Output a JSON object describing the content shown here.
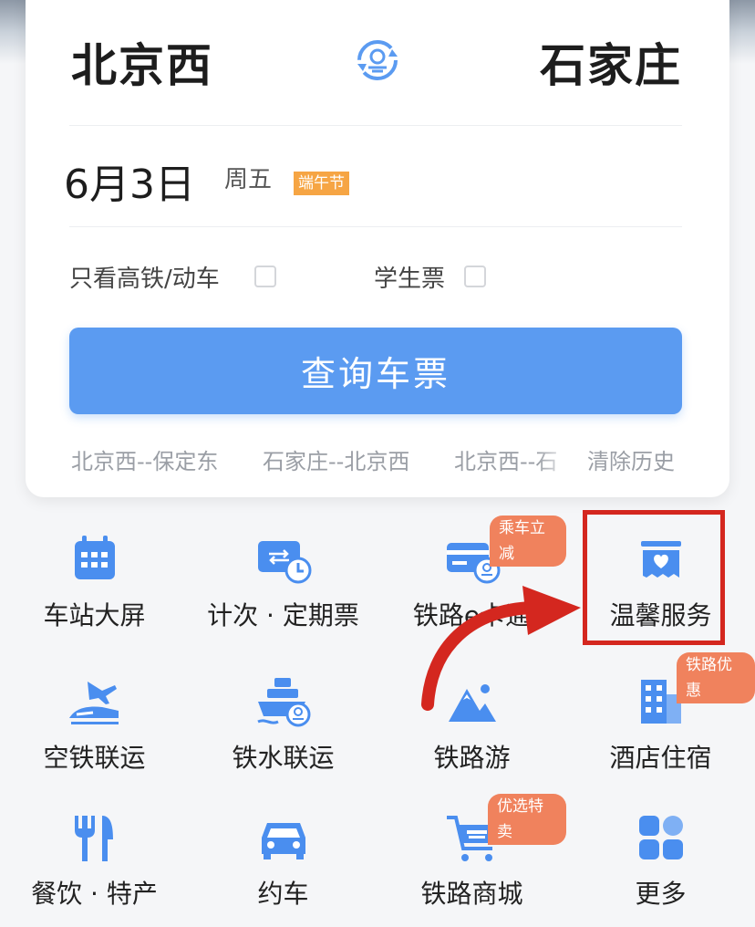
{
  "booking": {
    "from_station": "北京西",
    "to_station": "石家庄",
    "date": "6月3日",
    "weekday": "周五",
    "festival_tag": "端午节",
    "options": [
      {
        "label": "只看高铁/动车",
        "checked": false
      },
      {
        "label": "学生票",
        "checked": false
      }
    ],
    "search_label": "查询车票",
    "history": [
      "北京西--保定东",
      "石家庄--北京西",
      "北京西--石",
      "清除历史"
    ]
  },
  "services": [
    {
      "label": "车站大屏",
      "icon": "station-screen-icon"
    },
    {
      "label": "计次 · 定期票",
      "icon": "period-ticket-icon"
    },
    {
      "label": "铁路e卡通",
      "icon": "ecard-icon",
      "badge": "乘车立减"
    },
    {
      "label": "温馨服务",
      "icon": "warm-service-icon"
    },
    {
      "label": "空铁联运",
      "icon": "air-rail-icon"
    },
    {
      "label": "铁水联运",
      "icon": "rail-water-icon"
    },
    {
      "label": "铁路游",
      "icon": "rail-tour-icon"
    },
    {
      "label": "酒店住宿",
      "icon": "hotel-icon",
      "badge": "铁路优惠"
    },
    {
      "label": "餐饮 · 特产",
      "icon": "dining-icon"
    },
    {
      "label": "约车",
      "icon": "car-icon"
    },
    {
      "label": "铁路商城",
      "icon": "mall-cart-icon",
      "badge": "优选特卖"
    },
    {
      "label": "更多",
      "icon": "more-icon"
    }
  ],
  "colors": {
    "primary": "#5b9bf1",
    "badge": "#f0825d",
    "festival": "#f6a544",
    "highlight": "#d4271f"
  }
}
